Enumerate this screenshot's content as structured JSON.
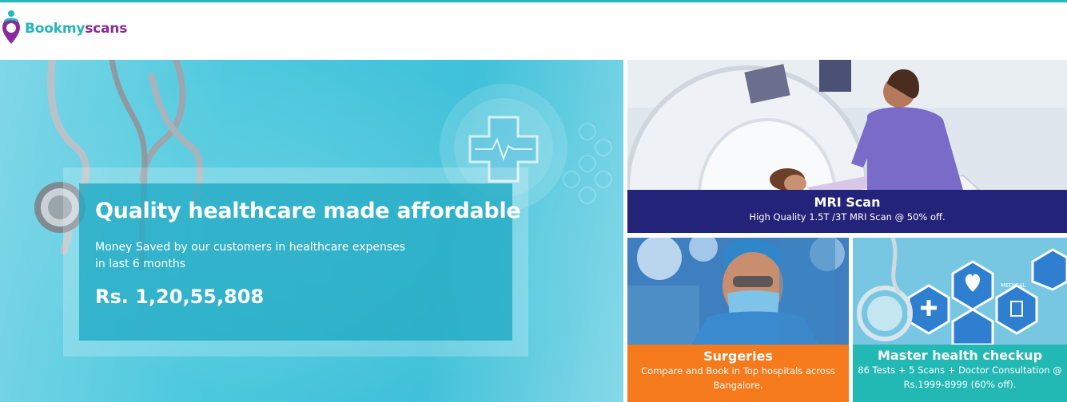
{
  "brand": {
    "name_part1": "Bookmy",
    "name_part2": "scans",
    "colors": {
      "teal": "#24b5c0",
      "purple": "#8a2b9b"
    }
  },
  "hero": {
    "title": "Quality healthcare made affordable",
    "subtitle_line1": "Money Saved by our customers in healthcare expenses",
    "subtitle_line2": "in last 6 months",
    "amount": "Rs. 1,20,55,808"
  },
  "cards": {
    "mri": {
      "title": "MRI Scan",
      "description": "High Quality 1.5T /3T MRI Scan @ 50% off.",
      "color": "#24237a"
    },
    "surgeries": {
      "title": "Surgeries",
      "description_line1": "Compare and Book in Top hospitals across",
      "description_line2": "Bangalore.",
      "color": "#f47a1c"
    },
    "master": {
      "title": "Master health checkup",
      "description_line1": "86 Tests + 5 Scans + Doctor Consultation @",
      "description_line2": "Rs.1999-8999 (60% off).",
      "icon_label": "MEDICAL",
      "color": "#22b8b4"
    }
  }
}
